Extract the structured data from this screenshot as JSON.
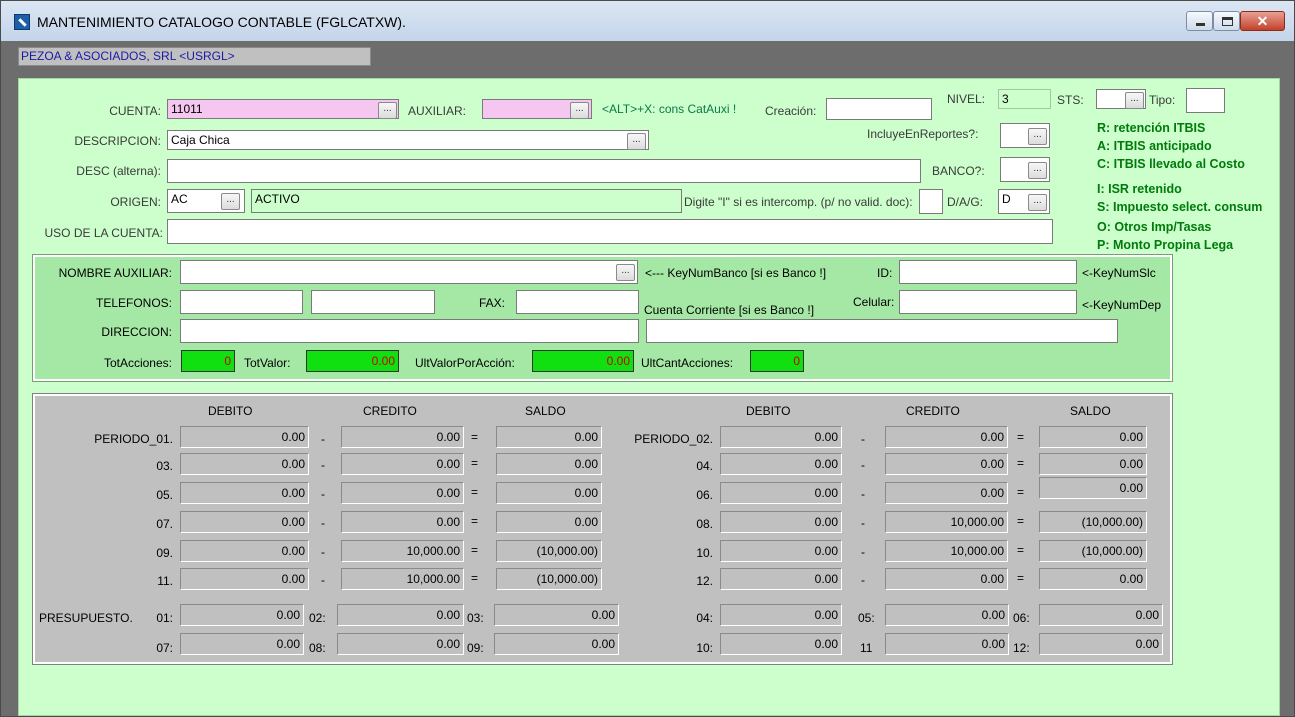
{
  "window": {
    "title": "MANTENIMIENTO CATALOGO CONTABLE (FGLCATXW).",
    "company": "PEZOA & ASOCIADOS, SRL  <USRGL>",
    "close_glyph": "✕"
  },
  "form": {
    "cuenta_label": "CUENTA:",
    "cuenta_value": "11011",
    "auxiliar_label": "AUXILIAR:",
    "auxiliar_value": "",
    "alt_hint": "<ALT>+X: cons CatAuxi !",
    "creacion_label": "Creación:",
    "creacion_value": "",
    "nivel_label": "NIVEL:",
    "nivel_value": "3",
    "sts_label": "STS:",
    "tipo_label": "Tipo:",
    "tipo_value": "",
    "descripcion_label": "DESCRIPCION:",
    "descripcion_value": "Caja Chica",
    "incluye_label": "IncluyeEnReportes?:",
    "desc_alterna_label": "DESC (alterna):",
    "banco_label": "BANCO?:",
    "origen_label": "ORIGEN:",
    "origen_code": "AC",
    "origen_desc": "ACTIVO",
    "intercomp_label": "Digite \"I\" si es intercomp. (p/ no valid. doc):",
    "dag_label": "D/A/G:",
    "dag_value": "D",
    "uso_label": "USO DE LA CUENTA:",
    "dots": "..."
  },
  "legend": [
    "R: retención ITBIS",
    "A: ITBIS anticipado",
    "C: ITBIS llevado al Costo",
    "I:  ISR retenido",
    "S: Impuesto select. consum",
    "O: Otros Imp/Tasas",
    "P: Monto Propina Lega"
  ],
  "aux": {
    "nombre_label": "NOMBRE AUXILIAR:",
    "keynum_banco": "<--- KeyNumBanco [si es Banco !]",
    "id_label": "ID:",
    "keynum_slc": "<-KeyNumSlc",
    "telefonos_label": "TELEFONOS:",
    "fax_label": "FAX:",
    "cuenta_corriente": "Cuenta Corriente [si es Banco !]",
    "celular_label": "Celular:",
    "keynum_dep": "<-KeyNumDep",
    "direccion_label": "DIRECCION:",
    "tot_acciones_label": "TotAcciones:",
    "tot_acciones_value": "0",
    "tot_valor_label": "TotValor:",
    "tot_valor_value": "0.00",
    "ult_valor_label": "UltValorPorAcción:",
    "ult_valor_value": "0.00",
    "ult_cant_label": "UltCantAcciones:",
    "ult_cant_value": "0"
  },
  "periods": {
    "headers": {
      "debito": "DEBITO",
      "credito": "CREDITO",
      "saldo": "SALDO"
    },
    "minus": "-",
    "equals": "=",
    "left": [
      {
        "label": "PERIODO_01.",
        "debito": "0.00",
        "credito": "0.00",
        "saldo": "0.00"
      },
      {
        "label": "03.",
        "debito": "0.00",
        "credito": "0.00",
        "saldo": "0.00"
      },
      {
        "label": "05.",
        "debito": "0.00",
        "credito": "0.00",
        "saldo": "0.00"
      },
      {
        "label": "07.",
        "debito": "0.00",
        "credito": "0.00",
        "saldo": "0.00"
      },
      {
        "label": "09.",
        "debito": "0.00",
        "credito": "10,000.00",
        "saldo": "(10,000.00)"
      },
      {
        "label": "11.",
        "debito": "0.00",
        "credito": "10,000.00",
        "saldo": "(10,000.00)"
      }
    ],
    "right": [
      {
        "label": "PERIODO_02.",
        "debito": "0.00",
        "credito": "0.00",
        "saldo": "0.00"
      },
      {
        "label": "04.",
        "debito": "0.00",
        "credito": "0.00",
        "saldo": "0.00"
      },
      {
        "label": "06.",
        "debito": "0.00",
        "credito": "0.00",
        "saldo": "0.00"
      },
      {
        "label": "08.",
        "debito": "0.00",
        "credito": "10,000.00",
        "saldo": "(10,000.00)"
      },
      {
        "label": "10.",
        "debito": "0.00",
        "credito": "10,000.00",
        "saldo": "(10,000.00)"
      },
      {
        "label": "12.",
        "debito": "0.00",
        "credito": "0.00",
        "saldo": "0.00"
      }
    ]
  },
  "presupuesto": {
    "label": "PRESUPUESTO.",
    "row1": [
      {
        "label": "01:",
        "value": "0.00"
      },
      {
        "label": "02:",
        "value": "0.00"
      },
      {
        "label": "03:",
        "value": "0.00"
      },
      {
        "label": "04:",
        "value": "0.00"
      },
      {
        "label": "05:",
        "value": "0.00"
      },
      {
        "label": "06:",
        "value": "0.00"
      }
    ],
    "row2": [
      {
        "label": "07:",
        "value": "0.00"
      },
      {
        "label": "08:",
        "value": "0.00"
      },
      {
        "label": "09:",
        "value": "0.00"
      },
      {
        "label": "10:",
        "value": "0.00"
      },
      {
        "label": "11",
        "value": "0.00"
      },
      {
        "label": "12:",
        "value": "0.00"
      }
    ]
  }
}
